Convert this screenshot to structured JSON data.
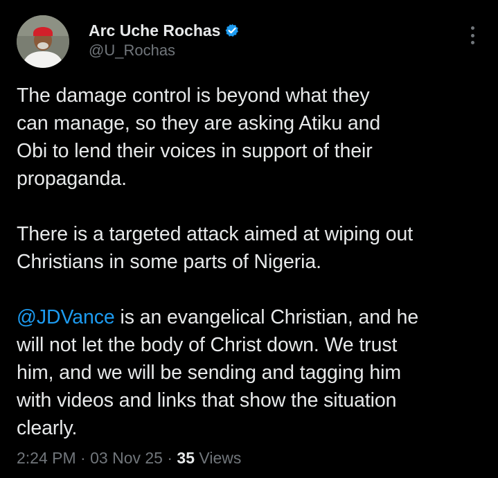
{
  "author": {
    "display_name": "Arc Uche Rochas",
    "handle": "@U_Rochas",
    "verified": true
  },
  "tweet": {
    "paragraph1": [
      "The damage control is beyond what they",
      "can manage, so they are asking Atiku and",
      "Obi to lend their voices in support of their",
      "propaganda."
    ],
    "paragraph2": [
      "There is a targeted attack aimed at wiping out",
      "Christians in some parts of Nigeria."
    ],
    "paragraph3": {
      "mention": "@JDVance",
      "first_line_rest": " is an evangelical Christian, and he",
      "lines": [
        "will not let the body of Christ down. We trust",
        "him, and we will be sending and tagging him",
        "with videos and links that show the situation",
        "clearly."
      ]
    }
  },
  "meta": {
    "time": "2:24 PM",
    "separator": " · ",
    "date": "03 Nov 25",
    "views_count": "35",
    "views_label": " Views"
  },
  "colors": {
    "background": "#000000",
    "text": "#e7e9ea",
    "secondary": "#71767b",
    "accent": "#1d9bf0"
  },
  "icons": {
    "verified": "verified-badge-icon",
    "more": "more-options-icon"
  }
}
